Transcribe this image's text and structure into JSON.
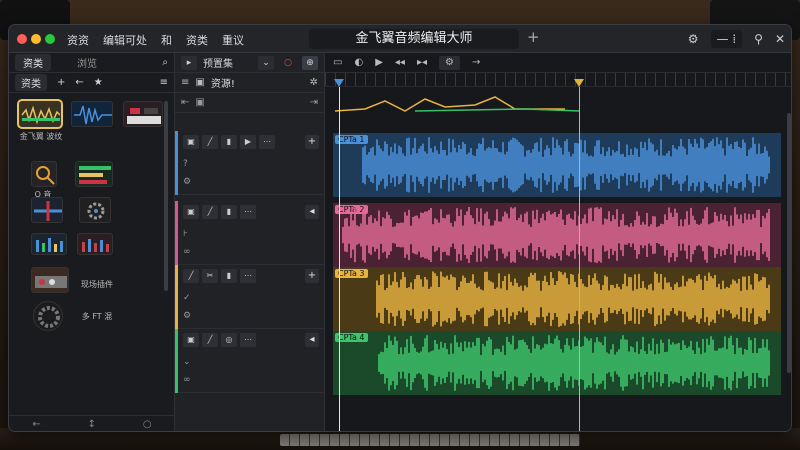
{
  "window": {
    "title": "金飞翼音频编辑大师",
    "menu": [
      "资资",
      "编辑可处",
      "和",
      "资类",
      "重议"
    ]
  },
  "titlebar_right": {
    "icons": [
      "gear-icon",
      "minus-icon",
      "split-icon",
      "pin-icon",
      "close-icon"
    ]
  },
  "browser": {
    "tab_label": "资类",
    "field_label": "浏览",
    "tools": [
      "资类",
      "+",
      "←",
      "★",
      "≡"
    ],
    "thumbnails": [
      {
        "label": "金飞翼\n波纹",
        "color": "#e8c460"
      },
      {
        "label": "",
        "color": "#4a90d9"
      },
      {
        "label": "",
        "color": "#cc3344"
      },
      {
        "label": "Q 音",
        "color": "#e8a030"
      },
      {
        "label": "",
        "color": "#39c06a"
      },
      {
        "label": "",
        "color": "#4a90d9"
      },
      {
        "label": "",
        "color": "#888"
      },
      {
        "label": "",
        "color": "#4a90d9"
      },
      {
        "label": "",
        "color": "#4a90d9"
      },
      {
        "label": "",
        "color": "#c04444"
      },
      {
        "label": "现场插件",
        "color": "#aaa"
      },
      {
        "label": "多 FT 混",
        "color": "#888"
      }
    ],
    "footer_icons": [
      "←",
      "↕",
      "○"
    ]
  },
  "headers": {
    "toolbar_label": "预置集",
    "sub_label": "资源!",
    "tracks": [
      {
        "color": "#4a90d9",
        "name": "轨道1"
      },
      {
        "color": "#d6588f",
        "name": "轨道2"
      },
      {
        "color": "#e8b341",
        "name": "轨道3"
      },
      {
        "color": "#39c06a",
        "name": "轨道4"
      }
    ]
  },
  "timeline": {
    "tools": [
      "▭",
      "◐",
      "▶",
      "◂◂",
      "▸◂",
      "⚙",
      "→"
    ],
    "clips": [
      {
        "label": "CPTa 1",
        "color": "#4a90d9",
        "bg": "#1f3b5a"
      },
      {
        "label": "CPTa 2",
        "color": "#e36b96",
        "bg": "#4a2234"
      },
      {
        "label": "CPTa 3",
        "color": "#e8b341",
        "bg": "#4a3a16"
      },
      {
        "label": "CPTa 4",
        "color": "#3ec46b",
        "bg": "#1b4a2a"
      }
    ]
  }
}
